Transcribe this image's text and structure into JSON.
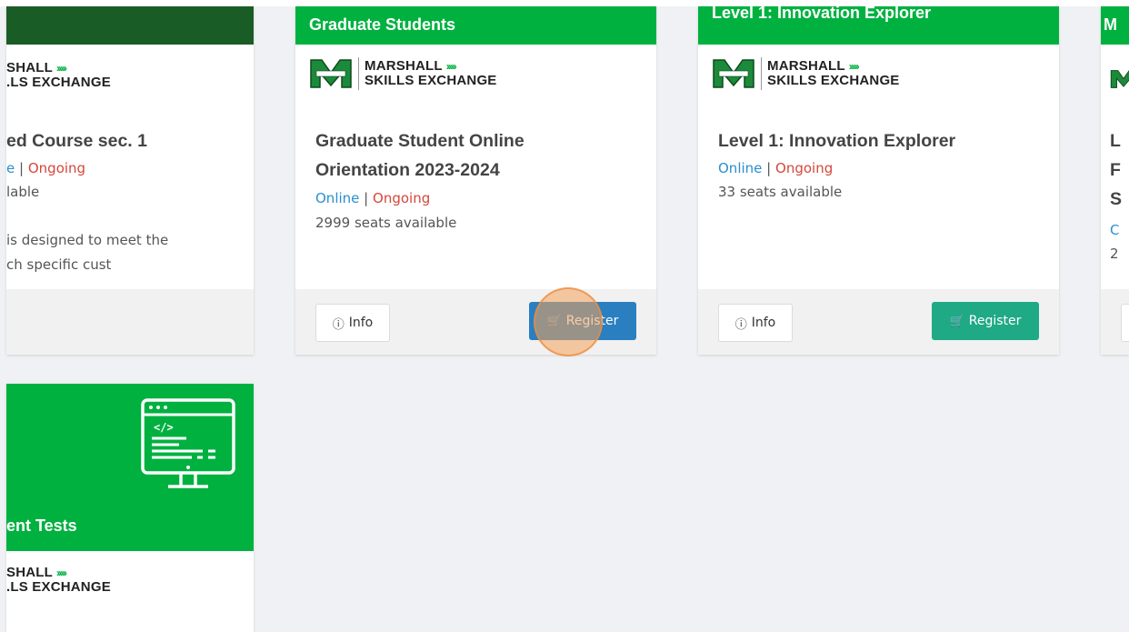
{
  "logo": {
    "line1": "MARSHALL",
    "line2": "SKILLS EXCHANGE",
    "chevrons": "›››››",
    "shield_text": "MARSHALL"
  },
  "cards": [
    {
      "header": "",
      "title_lines": [
        "ed Course sec. 1"
      ],
      "logo_line1": "SHALL",
      "logo_line2": ".LS EXCHANGE",
      "online": "e",
      "pipe": "|",
      "ongoing": "Ongoing",
      "seats": "lable",
      "desc_lines": [
        "is designed to meet the",
        "ch specific cust"
      ]
    },
    {
      "header": "Graduate Students",
      "title_lines": [
        "Graduate Student Online",
        "Orientation 2023-2024"
      ],
      "online": "Online",
      "pipe": "|",
      "ongoing": "Ongoing",
      "seats": "2999 seats available",
      "info_label": "Info",
      "register_label": "Register"
    },
    {
      "header": "Level 1: Innovation Explorer",
      "title_lines": [
        "Level 1: Innovation Explorer"
      ],
      "online": "Online",
      "pipe": "|",
      "ongoing": "Ongoing",
      "seats": "33 seats available",
      "info_label": "Info",
      "register_label": "Register"
    },
    {
      "header": "M",
      "title_lines": [
        "L",
        "F",
        "S"
      ],
      "online": "C",
      "seats": "2"
    },
    {
      "header": "ent Tests",
      "logo_line1": "SHALL",
      "logo_line2": ".LS EXCHANGE",
      "icon": "code-monitor-icon"
    }
  ],
  "colors": {
    "brand_green": "#00b140",
    "register_blue": "#2a7fc1",
    "register_teal": "#1fa985",
    "online_blue": "#2b8fcf",
    "ongoing_red": "#d4473a"
  }
}
